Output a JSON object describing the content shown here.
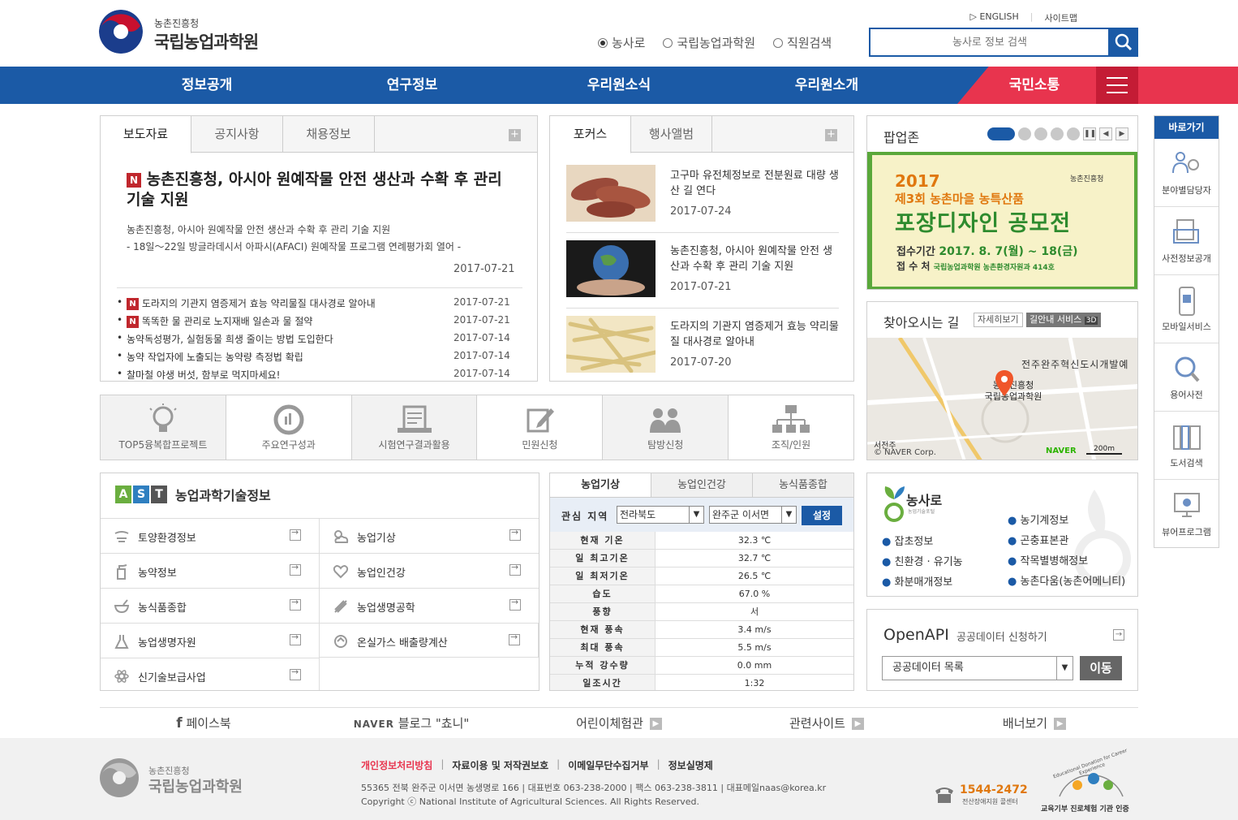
{
  "header": {
    "org_top": "농촌진흥청",
    "org_name": "국립농업과학원",
    "english": "▷ ENGLISH",
    "sitemap": "사이트맵",
    "search_scopes": [
      "농사로",
      "국립농업과학원",
      "직원검색"
    ],
    "search_placeholder": "농사로 정보 검색"
  },
  "nav": [
    "정보공개",
    "연구정보",
    "우리원소식",
    "우리원소개",
    "국민소통"
  ],
  "news": {
    "tabs": [
      "보도자료",
      "공지사항",
      "채용정보"
    ],
    "more": "+",
    "headline_badge": "N",
    "headline": "농촌진흥청, 아시아 원예작물 안전 생산과 수확 후 관리 기술 지원",
    "summary1": "농촌진흥청, 아시아 원예작물 안전 생산과 수확 후 관리 기술 지원",
    "summary2": "- 18일～22일 방글라데시서 아파시(AFACI) 원예작물 프로그램 연례평가회 열어 -",
    "headline_date": "2017-07-21",
    "items": [
      {
        "new": true,
        "title": "도라지의 기관지 염증제거 효능 약리물질 대사경로 알아내",
        "date": "2017-07-21"
      },
      {
        "new": true,
        "title": "똑똑한 물 관리로 노지재배 일손과 물 절약",
        "date": "2017-07-21"
      },
      {
        "new": false,
        "title": "농약독성평가, 실험동물 희생 줄이는 방법 도입한다",
        "date": "2017-07-14"
      },
      {
        "new": false,
        "title": "농약 작업자에 노출되는 농약량 측정법 확립",
        "date": "2017-07-14"
      },
      {
        "new": false,
        "title": "찰마철 야생 버섯, 함부로 먹지마세요!",
        "date": "2017-07-14"
      }
    ]
  },
  "focus": {
    "tabs": [
      "포커스",
      "행사앨범"
    ],
    "items": [
      {
        "title": "고구마 유전체정보로 전분원료 대량 생산 길 연다",
        "date": "2017-07-24"
      },
      {
        "title": "농촌진흥청, 아시아 원예작물 안전 생산과 수확 후 관리 기술 지원",
        "date": "2017-07-21"
      },
      {
        "title": "도라지의 기관지 염증제거 효능 약리물질 대사경로 알아내",
        "date": "2017-07-20"
      }
    ]
  },
  "popup": {
    "title": "팝업존",
    "banner_year": "2017",
    "banner_sub": "제3회 농촌마을 농특산품",
    "banner_main": "포장디자인 공모전",
    "banner_period_label": "접수기간",
    "banner_period": "2017. 8. 7(월) ~ 18(금)",
    "banner_place_label": "접 수 처",
    "banner_place": "국립농업과학원 농촌환경자원과 414호",
    "banner_org": "농촌진흥청"
  },
  "map": {
    "title": "찾아오시는 길",
    "detail_btn": "자세히보기",
    "guide_btn": "길안내 서비스",
    "guide_badge": "3D",
    "label_area": "전주완주혁신도시개발예",
    "label_org1": "농촌진흥청",
    "label_org2": "국립농업과학원",
    "label_station": "서전주",
    "copyright": "© NAVER Corp.",
    "naver": "NAVER",
    "scale": "200m"
  },
  "quick": [
    "TOP5융복합프로젝트",
    "주요연구성과",
    "시험연구결과활용",
    "민원신청",
    "탐방신청",
    "조직/인원"
  ],
  "ast": {
    "letters": [
      "A",
      "S",
      "T"
    ],
    "title": "농업과학기술정보",
    "items": [
      "토양환경정보",
      "농업기상",
      "농약정보",
      "농업인건강",
      "농식품종합",
      "농업생명공학",
      "농업생명자원",
      "온실가스 배출량계산",
      "신기술보급사업"
    ]
  },
  "weather": {
    "tabs": [
      "농업기상",
      "농업인건강",
      "농식품종합"
    ],
    "region_label": "관심 지역",
    "province": "전라북도",
    "town": "완주군 이서면",
    "set_btn": "설정",
    "rows": [
      {
        "k": "현재 기온",
        "v": "32.3 ℃"
      },
      {
        "k": "일 최고기온",
        "v": "32.7 ℃"
      },
      {
        "k": "일 최저기온",
        "v": "26.5 ℃"
      },
      {
        "k": "습도",
        "v": "67.0 %"
      },
      {
        "k": "풍향",
        "v": "서"
      },
      {
        "k": "현재 풍속",
        "v": "3.4 m/s"
      },
      {
        "k": "최대 풍속",
        "v": "5.5 m/s"
      },
      {
        "k": "누적 강수량",
        "v": "0.0 mm"
      },
      {
        "k": "일조시간",
        "v": "1:32"
      }
    ]
  },
  "nongsaro": {
    "logo": "농사로",
    "logo_sub": "농업기술포털",
    "left": [
      "잡초정보",
      "친환경 · 유기농",
      "화분매개정보"
    ],
    "right": [
      "농기계정보",
      "곤충표본관",
      "작목별병해정보",
      "농촌다움(농촌어메니티)"
    ]
  },
  "openapi": {
    "title": "OpenAPI",
    "sub": "공공데이터 신청하기",
    "select": "공공데이터 목록",
    "go": "이동"
  },
  "shortcut": {
    "title": "바로가기",
    "items": [
      "분야별담당자",
      "사전정보공개",
      "모바일서비스",
      "용어사전",
      "도서검색",
      "뷰어프로그램"
    ]
  },
  "footer_links": [
    "페이스북",
    "블로그 \"쵸니\"",
    "어린이체험관",
    "관련사이트",
    "배너보기"
  ],
  "footer": {
    "org_top": "농촌진흥청",
    "org_name": "국립농업과학원",
    "links": [
      "개인정보처리방침",
      "자료이용 및 저작권보호",
      "이메일무단수집거부",
      "정보실명제"
    ],
    "address": "55365 전북 완주군 이서면 농생명로 166 | 대표번호 063-238-2000 | 팩스 063-238-3811 | 대표메일naas@korea.kr",
    "copyright": "Copyright ⓒ National Institute of Agricultural Sciences. All Rights Reserved.",
    "call_number": "1544-2472",
    "call_label": "전산장애지원 콜센터",
    "cert_label": "교육기부 진로체험 기관 인증",
    "cert_ring": "Educational Donation for Career Experience"
  },
  "colors": {
    "primary": "#1b5aa6",
    "accent_red": "#e8344e",
    "new_badge": "#c0272d"
  }
}
